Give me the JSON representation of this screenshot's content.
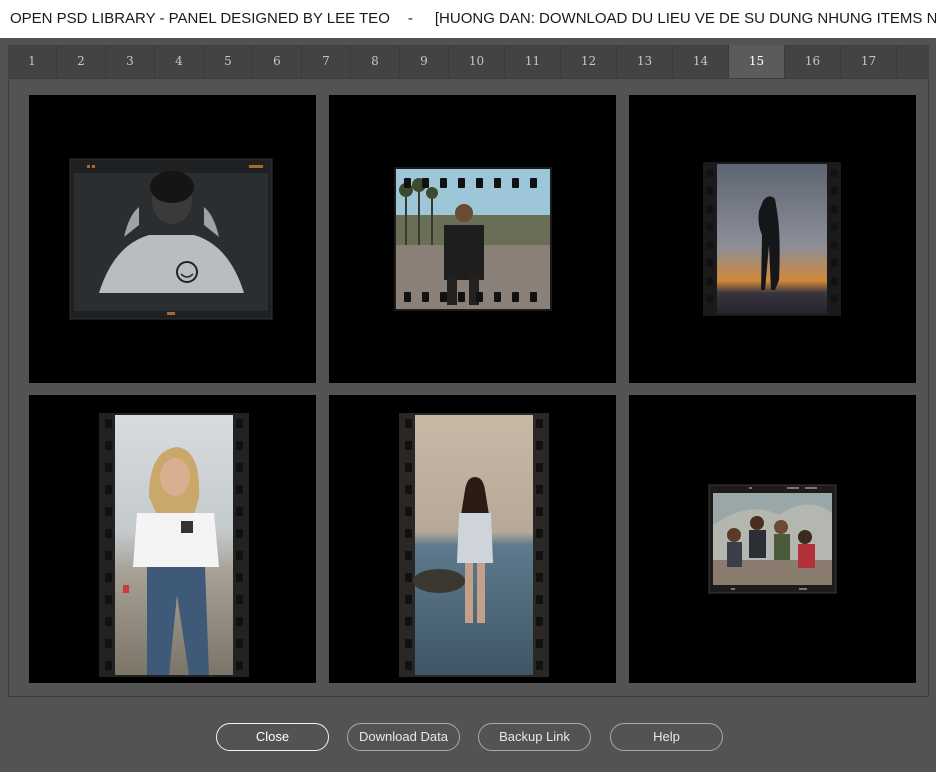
{
  "window": {
    "title_left": "OPEN PSD LIBRARY - PANEL DESIGNED BY LEE TEO",
    "title_sep": "-",
    "title_right": "[HUONG DAN: DOWNLOAD DU LIEU VE DE SU DUNG NHUNG ITEMS NAY]"
  },
  "tabs": [
    "1",
    "2",
    "3",
    "4",
    "5",
    "6",
    "7",
    "8",
    "9",
    "10",
    "11",
    "12",
    "13",
    "14",
    "15",
    "16",
    "17"
  ],
  "active_tab": "15",
  "items": [
    {
      "name": "preview-hoodie-man-frame",
      "kind": "photo-frame"
    },
    {
      "name": "preview-street-filmstrip",
      "kind": "filmstrip"
    },
    {
      "name": "preview-sunset-silhouette-filmstrip",
      "kind": "filmstrip"
    },
    {
      "name": "preview-woman-beach-filmstrip",
      "kind": "filmstrip-vertical"
    },
    {
      "name": "preview-woman-sea-filmstrip",
      "kind": "filmstrip-vertical"
    },
    {
      "name": "preview-group-friends-frame",
      "kind": "photo-frame"
    }
  ],
  "buttons": {
    "close": "Close",
    "download": "Download Data",
    "backup": "Backup Link",
    "help": "Help"
  }
}
